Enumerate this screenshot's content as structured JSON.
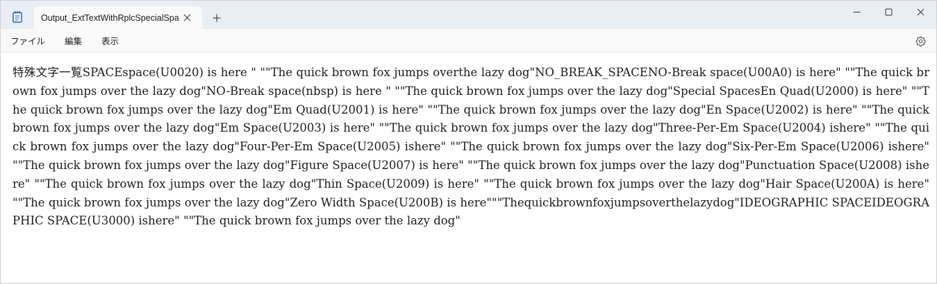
{
  "window": {
    "tab_title": "Output_ExtTextWithRplcSpecialSpa",
    "icons": {
      "app": "notepad-icon",
      "close_tab": "close-icon",
      "new_tab": "plus-icon",
      "minimize": "minimize-icon",
      "maximize": "maximize-icon",
      "close_window": "close-icon",
      "settings": "gear-icon"
    }
  },
  "menu": {
    "items": [
      "ファイル",
      "編集",
      "表示"
    ]
  },
  "editor": {
    "content": "特殊文字一覧SPACEspace(U0020) is here \" \"\"The quick brown fox jumps overthe lazy dog\"NO_BREAK_SPACENO-Break space(U00A0) is here\" \"\"The quick brown fox jumps over the lazy dog\"NO-Break space(nbsp) is here \" \"\"The quick brown fox jumps over the lazy dog\"Special SpacesEn Quad(U2000) is here\"  \"\"The quick brown fox jumps over the lazy dog\"Em Quad(U2001) is here\"  \"\"The quick brown fox jumps over the lazy dog\"En Space(U2002) is here\" \"\"The quick brown fox jumps over the lazy dog\"Em Space(U2003) is here\"  \"\"The quick brown fox jumps over the lazy dog\"Three-Per-Em Space(U2004) ishere\" \"\"The quick brown fox jumps over the lazy dog\"Four-Per-Em Space(U2005) ishere\" \"\"The quick brown fox jumps over the lazy dog\"Six-Per-Em Space(U2006) ishere\" \"\"The quick brown fox jumps over the lazy dog\"Figure Space(U2007) is here\"  \"\"The quick brown fox jumps over the lazy dog\"Punctuation Space(U2008) ishere\" \"\"The quick brown fox jumps over the lazy dog\"Thin Space(U2009) is here\" \"\"The quick brown fox jumps over the lazy dog\"Hair Space(U200A) is here\" \"\"The quick brown fox jumps over the lazy dog\"Zero Width Space(U200B) is here\"\"\"Thequickbrownfoxjumpsoverthelazydog\"IDEOGRAPHIC SPACEIDEOGRAPHIC SPACE(U3000) ishere\"  \"\"The quick brown fox jumps over the lazy dog\""
  },
  "colors": {
    "titlebar_bg": "#e9eef5",
    "tab_bg": "#f9f9f9",
    "menubar_bg": "#f9f9f9",
    "editor_bg": "#ffffff",
    "text": "#1a1a1a",
    "app_icon_accent": "#1e5aa8"
  }
}
